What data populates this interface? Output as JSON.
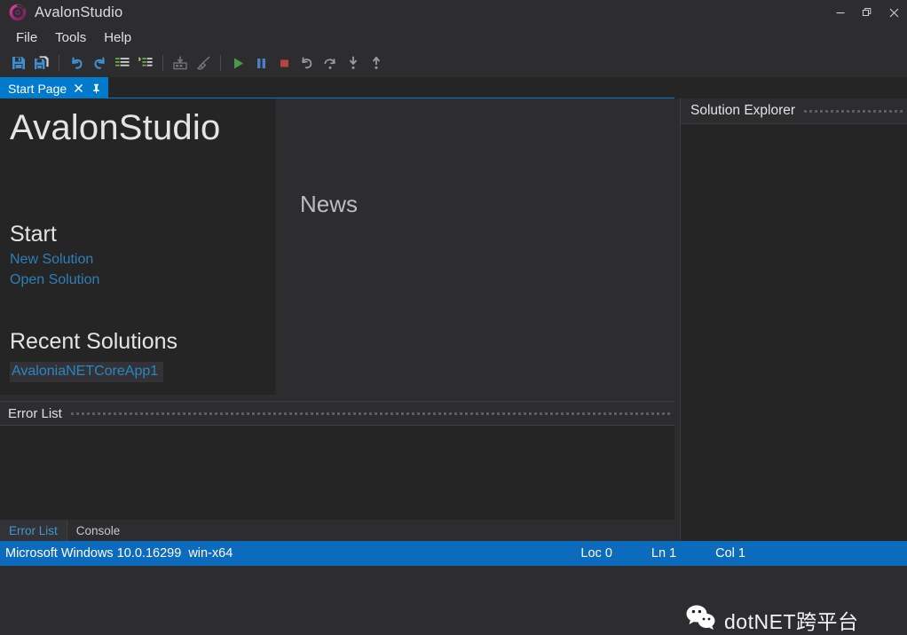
{
  "window": {
    "title": "AvalonStudio",
    "logo_icon": "avalonia-ring-logo",
    "controls": [
      {
        "name": "minimize",
        "icon": "minimize-icon"
      },
      {
        "name": "restore",
        "icon": "restore-icon"
      },
      {
        "name": "close",
        "icon": "close-icon"
      }
    ]
  },
  "menu": {
    "items": [
      {
        "label": "File"
      },
      {
        "label": "Tools"
      },
      {
        "label": "Help"
      }
    ]
  },
  "toolbar": {
    "groups": [
      {
        "buttons": [
          {
            "name": "save",
            "icon": "save-icon",
            "enabled": true
          },
          {
            "name": "save-all",
            "icon": "save-all-icon",
            "enabled": true
          }
        ]
      },
      {
        "buttons": [
          {
            "name": "undo",
            "icon": "undo-icon",
            "enabled": true
          },
          {
            "name": "redo",
            "icon": "redo-icon",
            "enabled": true
          },
          {
            "name": "comment",
            "icon": "comment-lines-icon",
            "enabled": true
          },
          {
            "name": "uncomment",
            "icon": "uncomment-lines-icon",
            "enabled": true
          }
        ]
      },
      {
        "buttons": [
          {
            "name": "build",
            "icon": "build-icon",
            "enabled": false
          },
          {
            "name": "clean",
            "icon": "broom-clean-icon",
            "enabled": false
          }
        ]
      },
      {
        "buttons": [
          {
            "name": "start-debug",
            "icon": "play-icon",
            "enabled": true
          },
          {
            "name": "pause",
            "icon": "pause-icon",
            "enabled": true
          },
          {
            "name": "stop",
            "icon": "stop-icon",
            "enabled": true
          },
          {
            "name": "restart",
            "icon": "restart-icon",
            "enabled": true
          },
          {
            "name": "step-over",
            "icon": "step-over-icon",
            "enabled": true
          },
          {
            "name": "step-into",
            "icon": "step-into-icon",
            "enabled": true
          },
          {
            "name": "step-out",
            "icon": "step-out-icon",
            "enabled": true
          }
        ]
      }
    ]
  },
  "document_tabs": {
    "active": {
      "label": "Start Page",
      "close_icon": "close-icon",
      "pin_icon": "pin-icon"
    }
  },
  "start_page": {
    "heading": "AvalonStudio",
    "start_section": {
      "heading": "Start",
      "links": [
        {
          "label": "New Solution"
        },
        {
          "label": "Open Solution"
        }
      ]
    },
    "recent_section": {
      "heading": "Recent Solutions",
      "items": [
        {
          "label": "AvaloniaNETCoreApp1"
        }
      ]
    },
    "news_heading": "News"
  },
  "error_panel": {
    "header_title": "Error List",
    "tabs": [
      {
        "label": "Error List",
        "active": true
      },
      {
        "label": "Console",
        "active": false
      }
    ]
  },
  "solution_explorer": {
    "title": "Solution Explorer"
  },
  "watermark": {
    "icon": "wechat-icon",
    "text": "dotNET跨平台"
  },
  "status_bar": {
    "platform": "Microsoft Windows 10.0.16299  win-x64",
    "loc": "Loc 0",
    "line": "Ln 1",
    "column": "Col 1"
  },
  "colors": {
    "accent": "#007acc",
    "status_bar": "#0d6bbd",
    "link": "#2f7fb5",
    "chrome": "#2d2d30",
    "panel": "#252526",
    "logo": "#c0369a"
  }
}
